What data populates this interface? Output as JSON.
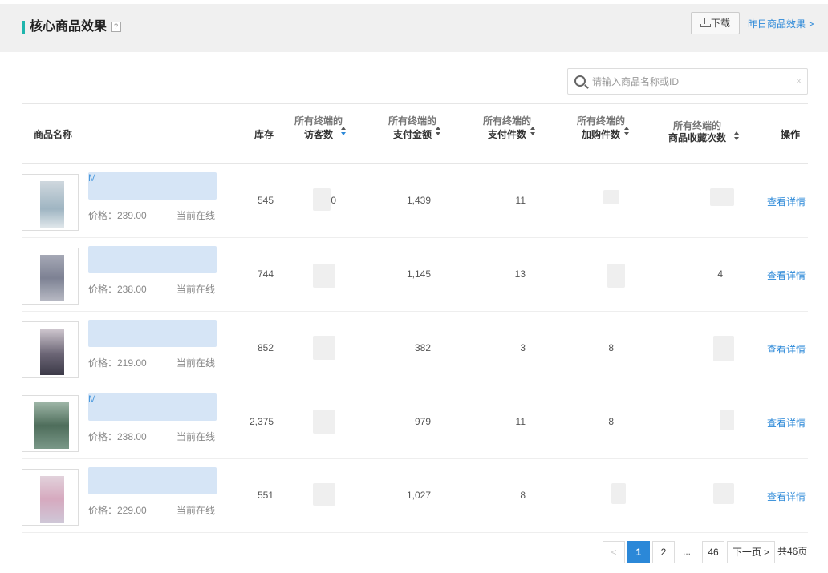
{
  "header": {
    "title": "核心商品效果",
    "help_label": "?",
    "download_label": "下载",
    "yesterday_link": "昨日商品效果 >"
  },
  "search": {
    "placeholder": "请输入商品名称或ID",
    "value": "",
    "clear_label": "×"
  },
  "table": {
    "columns": [
      {
        "line1": "",
        "line2": "商品名称"
      },
      {
        "line1": "",
        "line2": "库存"
      },
      {
        "line1": "所有终端的",
        "line2": "访客数"
      },
      {
        "line1": "所有终端的",
        "line2": "支付金额"
      },
      {
        "line1": "所有终端的",
        "line2": "支付件数"
      },
      {
        "line1": "所有终端的",
        "line2": "加购件数"
      },
      {
        "line1": "所有终端的",
        "line2": "商品收藏次数"
      },
      {
        "line1": "",
        "line2": "操作"
      }
    ],
    "rows": [
      {
        "name_visible": "M",
        "price": "价格：239.00",
        "status": "当前在线",
        "stock": "545",
        "visitors": "0",
        "pay_amount": "1,439",
        "pay_items": "11",
        "cart_items": "",
        "favorites": "",
        "action": "查看详情"
      },
      {
        "name_visible": "",
        "price": "价格：238.00",
        "status": "当前在线",
        "stock": "744",
        "visitors": "",
        "pay_amount": "1,145",
        "pay_items": "13",
        "cart_items": "",
        "favorites": "4",
        "action": "查看详情"
      },
      {
        "name_visible": "",
        "price": "价格：219.00",
        "status": "当前在线",
        "stock": "852",
        "visitors": "",
        "pay_amount": "382",
        "pay_items": "3",
        "cart_items": "8",
        "favorites": "",
        "action": "查看详情"
      },
      {
        "name_visible": "M",
        "price": "价格：238.00",
        "status": "当前在线",
        "stock": "2,375",
        "visitors": "",
        "pay_amount": "979",
        "pay_items": "11",
        "cart_items": "8",
        "favorites": "",
        "action": "查看详情"
      },
      {
        "name_visible": "",
        "price": "价格：229.00",
        "status": "当前在线",
        "stock": "551",
        "visitors": "",
        "pay_amount": "1,027",
        "pay_items": "8",
        "cart_items": "",
        "favorites": "",
        "action": "查看详情"
      }
    ]
  },
  "pagination": {
    "prev_label": "<",
    "pages": [
      "1",
      "2"
    ],
    "ellipsis": "...",
    "last_page": "46",
    "next_label": "下一页 >",
    "total_label": "共46页",
    "current_page": "1"
  },
  "colors": {
    "accent": "#2b88d8",
    "title_bar": "#1fb5ad"
  }
}
